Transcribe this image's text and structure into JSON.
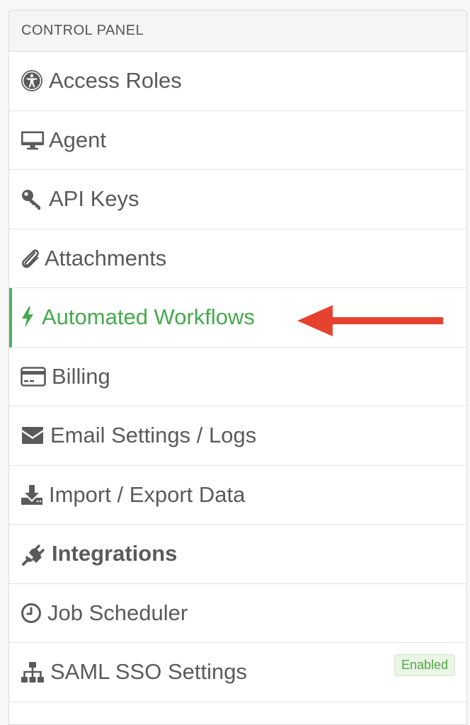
{
  "panel": {
    "header": "CONTROL PANEL"
  },
  "menu": {
    "items": [
      {
        "label": "Access Roles",
        "icon": "universal-access-icon"
      },
      {
        "label": "Agent",
        "icon": "desktop-monitor-icon"
      },
      {
        "label": "API Keys",
        "icon": "key-icon"
      },
      {
        "label": "Attachments",
        "icon": "paperclip-icon"
      },
      {
        "label": "Automated Workflows",
        "icon": "lightning-bolt-icon",
        "active": true
      },
      {
        "label": "Billing",
        "icon": "credit-card-icon"
      },
      {
        "label": "Email Settings / Logs",
        "icon": "envelope-icon"
      },
      {
        "label": "Import / Export Data",
        "icon": "download-icon"
      },
      {
        "label": "Integrations",
        "icon": "plug-icon"
      },
      {
        "label": "Job Scheduler",
        "icon": "clock-icon"
      },
      {
        "label": "SAML SSO Settings",
        "icon": "sitemap-icon",
        "badge": "Enabled"
      }
    ]
  },
  "colors": {
    "active": "#44a94f",
    "arrow": "#e5432f",
    "badge_text": "#52a84a",
    "badge_bg": "#eaf6e6"
  },
  "annotation": {
    "icon": "red-arrow-icon"
  }
}
